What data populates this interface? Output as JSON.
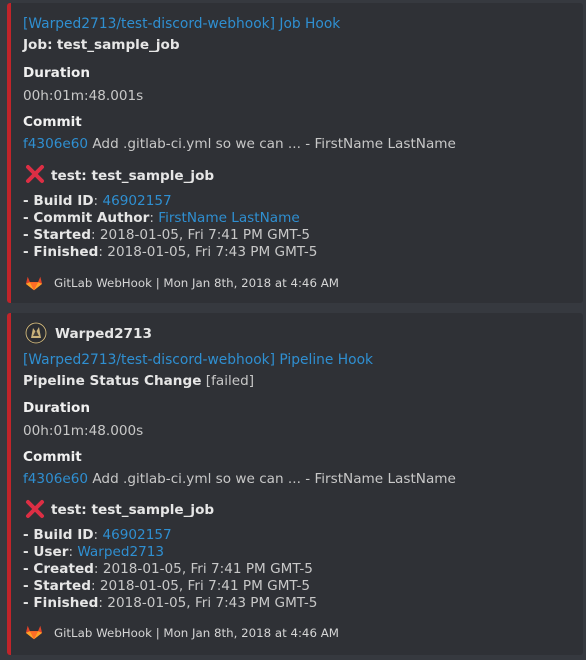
{
  "embeds": [
    {
      "title": "[Warped2713/test-discord-webhook] Job Hook",
      "subtitle_label": "Job:",
      "subtitle_value": "test_sample_job",
      "duration_label": "Duration",
      "duration_value": "00h:01m:48.001s",
      "commit_label": "Commit",
      "commit_hash": "f4306e60",
      "commit_msg": "Add .gitlab-ci.yml so we can ... - FirstName LastName",
      "job_title": "test: test_sample_job",
      "details": [
        {
          "prefix": "- ",
          "label": "Build ID",
          "sep": ": ",
          "value": "46902157",
          "link": true
        },
        {
          "prefix": "- ",
          "label": "Commit Author",
          "sep": ": ",
          "value": "FirstName LastName",
          "link": true
        },
        {
          "prefix": "- ",
          "label": "Started",
          "sep": ": ",
          "value": "2018-01-05, Fri 7:41 PM GMT-5",
          "link": false
        },
        {
          "prefix": "- ",
          "label": "Finished",
          "sep": ": ",
          "value": "2018-01-05, Fri 7:43 PM GMT-5",
          "link": false
        }
      ],
      "footer": "GitLab WebHook | Mon Jan 8th, 2018 at 4:46 AM"
    },
    {
      "author": "Warped2713",
      "title": "[Warped2713/test-discord-webhook] Pipeline Hook",
      "subtitle_label": "Pipeline Status Change",
      "subtitle_value": "[failed]",
      "duration_label": "Duration",
      "duration_value": "00h:01m:48.000s",
      "commit_label": "Commit",
      "commit_hash": "f4306e60",
      "commit_msg": "Add .gitlab-ci.yml so we can ... - FirstName LastName",
      "job_title": "test: test_sample_job",
      "details": [
        {
          "prefix": "- ",
          "label": "Build ID",
          "sep": ": ",
          "value": "46902157",
          "link": true
        },
        {
          "prefix": "- ",
          "label": "User",
          "sep": ": ",
          "value": "Warped2713",
          "link": true
        },
        {
          "prefix": "- ",
          "label": "Created",
          "sep": ": ",
          "value": "2018-01-05, Fri 7:41 PM GMT-5",
          "link": false
        },
        {
          "prefix": "- ",
          "label": "Started",
          "sep": ": ",
          "value": "2018-01-05, Fri 7:41 PM GMT-5",
          "link": false
        },
        {
          "prefix": "- ",
          "label": "Finished",
          "sep": ": ",
          "value": "2018-01-05, Fri 7:43 PM GMT-5",
          "link": false
        }
      ],
      "footer": "GitLab WebHook | Mon Jan 8th, 2018 at 4:46 AM"
    }
  ],
  "colors": {
    "accent": "#c0242a",
    "link": "#2f8fd1",
    "background": "#36393f",
    "embed": "#2f3136"
  },
  "icons": {
    "fail": "x-mark-icon",
    "footer": "gitlab-icon",
    "avatar": "avatar"
  }
}
